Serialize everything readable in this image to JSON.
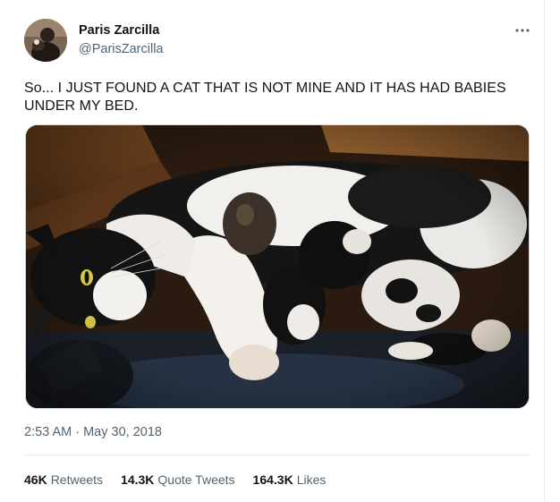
{
  "author": {
    "name": "Paris Zarcilla",
    "handle": "@ParisZarcilla"
  },
  "more_icon": "more-horizontal-icon",
  "tweet": {
    "text": "So... I JUST FOUND A CAT THAT IS NOT MINE AND IT HAS HAD BABIES UNDER MY BED.",
    "timestamp": "2:53 AM · May 30, 2018"
  },
  "stats": {
    "retweets_count": "46K",
    "retweets_label": "Retweets",
    "quotes_count": "14.3K",
    "quotes_label": "Quote Tweets",
    "likes_count": "164.3K",
    "likes_label": "Likes"
  },
  "colors": {
    "text_primary": "#0f1419",
    "text_secondary": "#536471",
    "divider": "#e6ecf0"
  }
}
